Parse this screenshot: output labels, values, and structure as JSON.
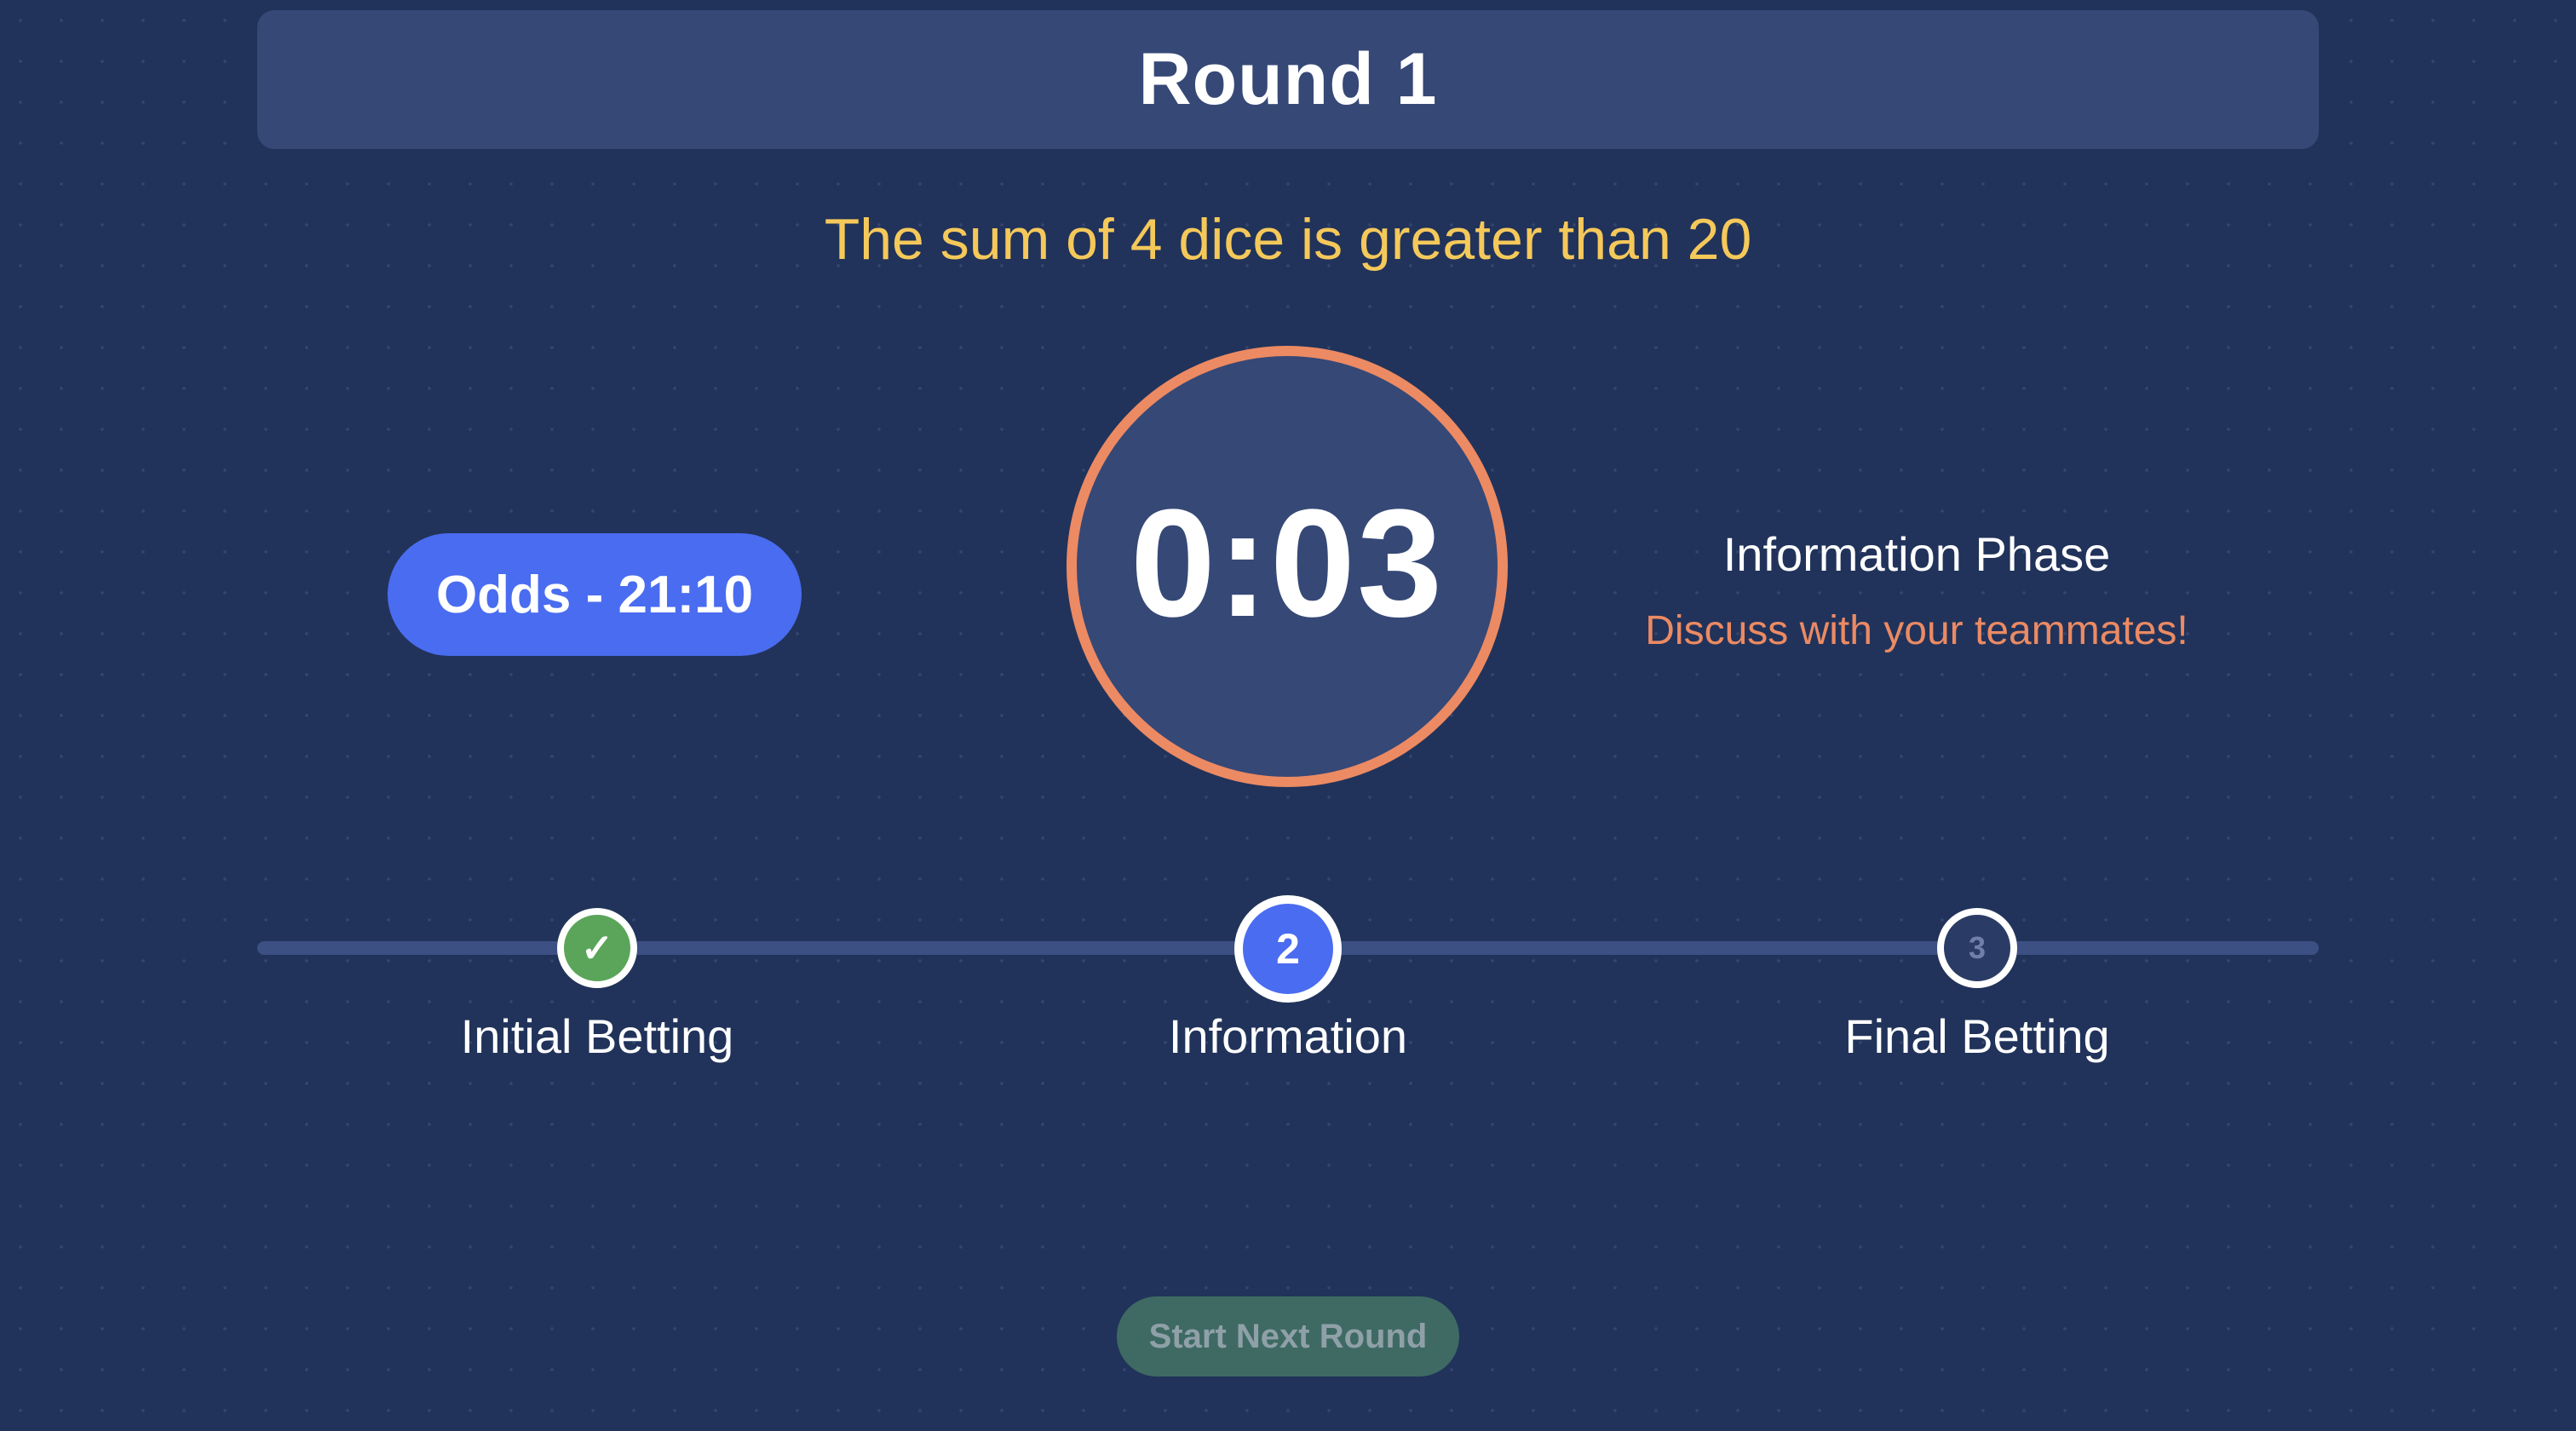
{
  "header": {
    "title": "Round 1"
  },
  "question": {
    "text": "The sum of 4 dice is greater than 20"
  },
  "odds": {
    "label": "Odds - 21:10"
  },
  "timer": {
    "value": "0:03"
  },
  "phase": {
    "title": "Information Phase",
    "subtitle": "Discuss with your teammates!"
  },
  "steps": [
    {
      "marker": "✓",
      "label": "Initial Betting",
      "status": "completed"
    },
    {
      "marker": "2",
      "label": "Information",
      "status": "active"
    },
    {
      "marker": "3",
      "label": "Final Betting",
      "status": "upcoming"
    }
  ],
  "actions": {
    "next_round_label": "Start Next Round",
    "next_round_enabled": false
  },
  "colors": {
    "background": "#21335a",
    "panel": "#364876",
    "accent_blue": "#4a6cf0",
    "accent_orange": "#ec8a63",
    "question_yellow": "#f5c85a",
    "completed_green": "#5aa55a",
    "button_disabled": "#3e6a63"
  }
}
